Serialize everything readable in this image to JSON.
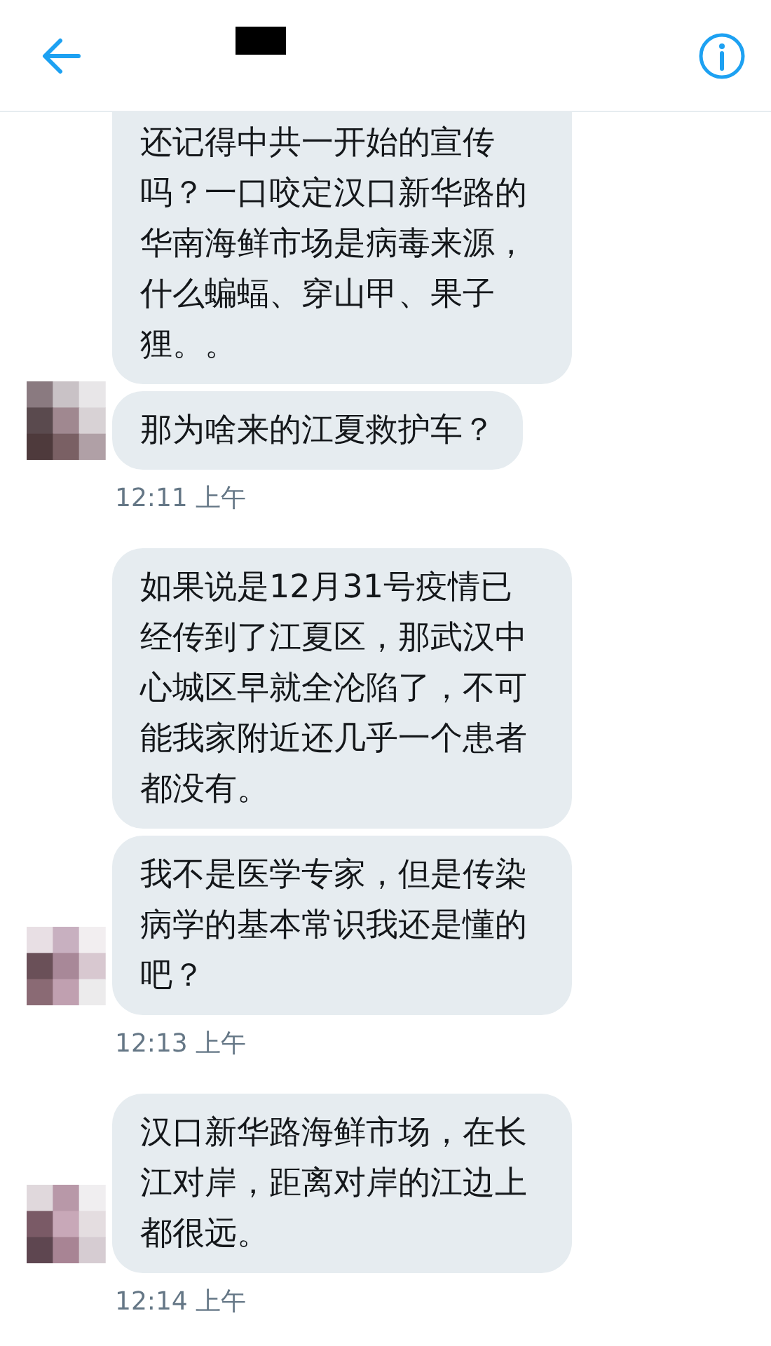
{
  "groups": [
    {
      "messages": [
        "还记得中共一开始的宣传吗？一口咬定汉口新华路的华南海鲜市场是病毒来源，什么蝙蝠、穿山甲、果子狸。。",
        "那为啥来的江夏救护车？"
      ],
      "time": "12:11 上午"
    },
    {
      "messages": [
        "如果说是12月31号疫情已经传到了江夏区，那武汉中心城区早就全沦陷了，不可能我家附近还几乎一个患者都没有。",
        "我不是医学专家，但是传染病学的基本常识我还是懂的吧？"
      ],
      "time": "12:13 上午"
    },
    {
      "messages": [
        "汉口新华路海鲜市场，在长江对岸，距离对岸的江边上都很远。"
      ],
      "time": "12:14 上午"
    }
  ]
}
